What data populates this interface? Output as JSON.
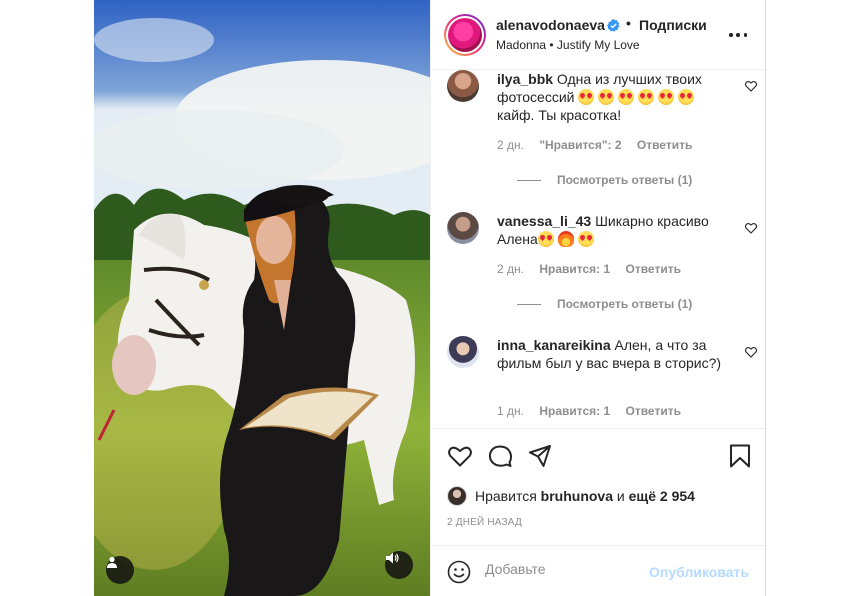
{
  "post": {
    "username": "alenavodonaeva",
    "follow_label": "Подписки",
    "separator": "•",
    "audio": "Madonna • Justify My Love"
  },
  "comments": [
    {
      "username": "ilya_bbk",
      "text_before": "Одна из лучших твоих фотосессий",
      "text_after": "кайф. Ты красотка!",
      "time": "2 дн.",
      "likes": "\"Нравится\": 2",
      "reply": "Ответить",
      "view_replies": "Посмотреть ответы (1)"
    },
    {
      "username": "vanessa_li_43",
      "text": "Шикарно красиво Алена",
      "time": "2 дн.",
      "likes": "Нравится: 1",
      "reply": "Ответить",
      "view_replies": "Посмотреть ответы (1)"
    },
    {
      "username": "inna_kanareikina",
      "text": "Ален, а что за фильм был у вас вчера в сторис?)",
      "time": "1 дн.",
      "likes": "Нравится: 1",
      "reply": "Ответить"
    }
  ],
  "likes": {
    "prefix": "Нравится",
    "user": "bruhunova",
    "middle": "и",
    "rest": "ещё 2 954"
  },
  "date": "2 ДНЕЙ НАЗАД",
  "comment_box": {
    "placeholder": "Добавьте",
    "publish_label": "Опубликовать"
  },
  "icons": [
    "heart-icon",
    "comment-icon",
    "share-icon",
    "bookmark-icon",
    "more-icon",
    "verified-icon",
    "emoji-icon",
    "user-tag-icon",
    "sound-icon"
  ],
  "colors": {
    "verified": "#3897f0",
    "publish_disabled": "#b3dbff",
    "meta": "#8e8e8e"
  }
}
